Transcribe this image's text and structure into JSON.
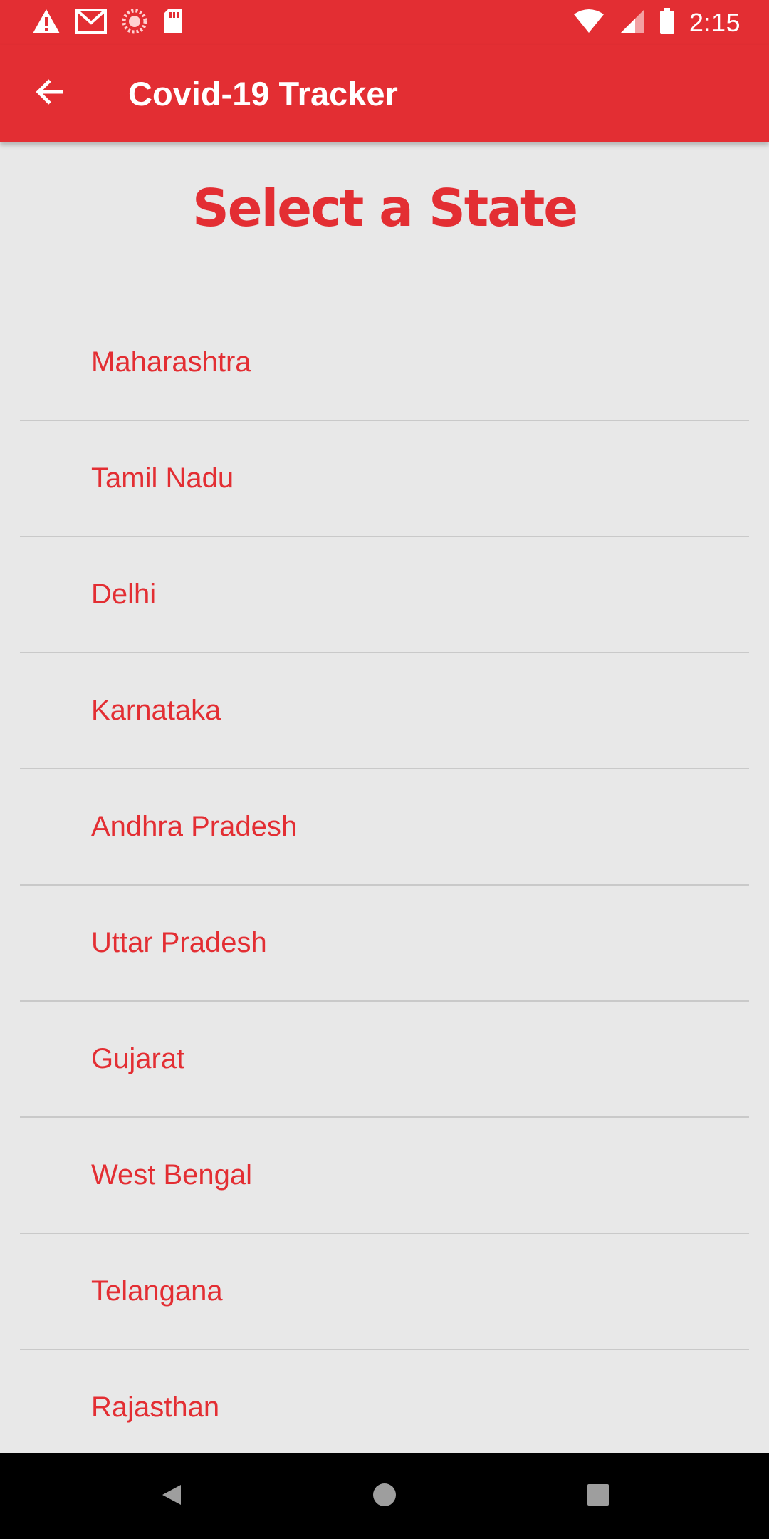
{
  "status_bar": {
    "time": "2:15",
    "icons_left": [
      "warning-icon",
      "gmail-icon",
      "sync-icon",
      "sd-card-icon"
    ],
    "icons_right": [
      "wifi-icon",
      "cell-signal-icon",
      "battery-icon"
    ]
  },
  "app_bar": {
    "title": "Covid-19 Tracker",
    "back_icon": "arrow-back-icon"
  },
  "heading": "Select a State",
  "states": [
    {
      "label": "Maharashtra"
    },
    {
      "label": "Tamil Nadu"
    },
    {
      "label": "Delhi"
    },
    {
      "label": "Karnataka"
    },
    {
      "label": "Andhra Pradesh"
    },
    {
      "label": "Uttar Pradesh"
    },
    {
      "label": "Gujarat"
    },
    {
      "label": "West Bengal"
    },
    {
      "label": "Telangana"
    },
    {
      "label": "Rajasthan"
    }
  ],
  "nav_bar": {
    "buttons": [
      "back-triangle-icon",
      "home-circle-icon",
      "recents-square-icon"
    ]
  },
  "colors": {
    "primary": "#e32e33",
    "background": "#e8e8e8",
    "divider": "#c9c9c9",
    "nav_bar": "#000000"
  }
}
